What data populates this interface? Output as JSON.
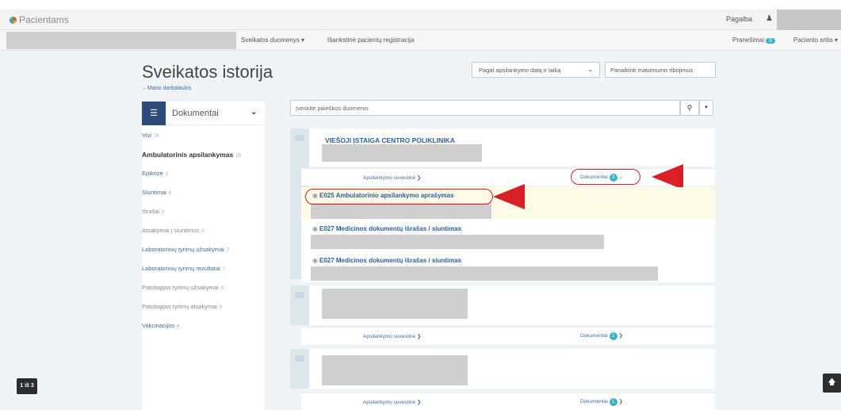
{
  "topbar": {
    "app_name": "Pacientams",
    "help": "Pagalba"
  },
  "navbar": {
    "health_data": "Sveikatos duomenys ▾",
    "registration": "Išankstinė pacientų registracija",
    "messages": "Pranešimai",
    "messages_count": "0",
    "patient_area": "Paciento sritis ▾"
  },
  "page": {
    "title": "Sveikatos istorija",
    "back_link": "←Mano darbalaukis",
    "sort_label": "Pagal apsilankymo datą ir laiką",
    "reset_label": "Panaikinti matomumo ribojimus"
  },
  "sidebar": {
    "title": "Dokumentai",
    "items": [
      {
        "label": "Visi",
        "count": "78",
        "style": "link"
      },
      {
        "label": "Ambulatorinis apsilankymas",
        "count": "29",
        "style": "active"
      },
      {
        "label": "Epikrizė",
        "count": "1",
        "style": "link"
      },
      {
        "label": "Siuntimai",
        "count": "6",
        "style": "link"
      },
      {
        "label": "Išrašai",
        "count": "0",
        "style": "muted"
      },
      {
        "label": "Atsakymai į siuntimus",
        "count": "0",
        "style": "muted"
      },
      {
        "label": "Laboratorinių tyrimų užsakymai",
        "count": "7",
        "style": "link"
      },
      {
        "label": "Laboratorinių tyrimų rezultatai",
        "count": "7",
        "style": "link"
      },
      {
        "label": "Patologijos tyrimų užsakymai",
        "count": "0",
        "style": "muted"
      },
      {
        "label": "Patologijos tyrimų atsakymai",
        "count": "0",
        "style": "muted"
      },
      {
        "label": "Vakcinacijos",
        "count": "4",
        "style": "link"
      }
    ]
  },
  "search": {
    "placeholder": "Įveskite paieškos duomenis"
  },
  "cards": [
    {
      "org": "VIEŠOJI ĮSTAIGA CENTRO POLIKLINIKA",
      "summary_link": "Apsilankymo suvestinė ❯",
      "docs_label": "Dokumentai",
      "docs_count": "3",
      "docs_chevron": "✓",
      "documents": [
        {
          "title": "E025 Ambulatorinio apsilankymo aprašymas"
        },
        {
          "title": "E027 Medicinos dokumentų išrašas / siuntimas"
        },
        {
          "title": "E027 Medicinos dokumentų išrašas / siuntimas"
        }
      ]
    },
    {
      "org": "",
      "summary_link": "Apsilankymo suvestinė ❯",
      "docs_label": "Dokumentai",
      "docs_count": "2",
      "docs_chevron": "❯"
    },
    {
      "org": "",
      "summary_link": "Apsilankymo suvestinė ❯",
      "docs_label": "Dokumentai",
      "docs_count": "1",
      "docs_chevron": "❯"
    }
  ],
  "pager": {
    "label": "1 iš 3"
  },
  "icons": {
    "list": "list-icon",
    "chevron": "chevron-down-icon",
    "search": "search-icon",
    "eye": "eye-icon",
    "user": "user-icon",
    "to_top": "arrow-up-icon"
  },
  "colors": {
    "accent": "#2c4a7a",
    "badge": "#3bb3c3",
    "link": "#3a6ea5",
    "annotation": "#d81f26"
  }
}
